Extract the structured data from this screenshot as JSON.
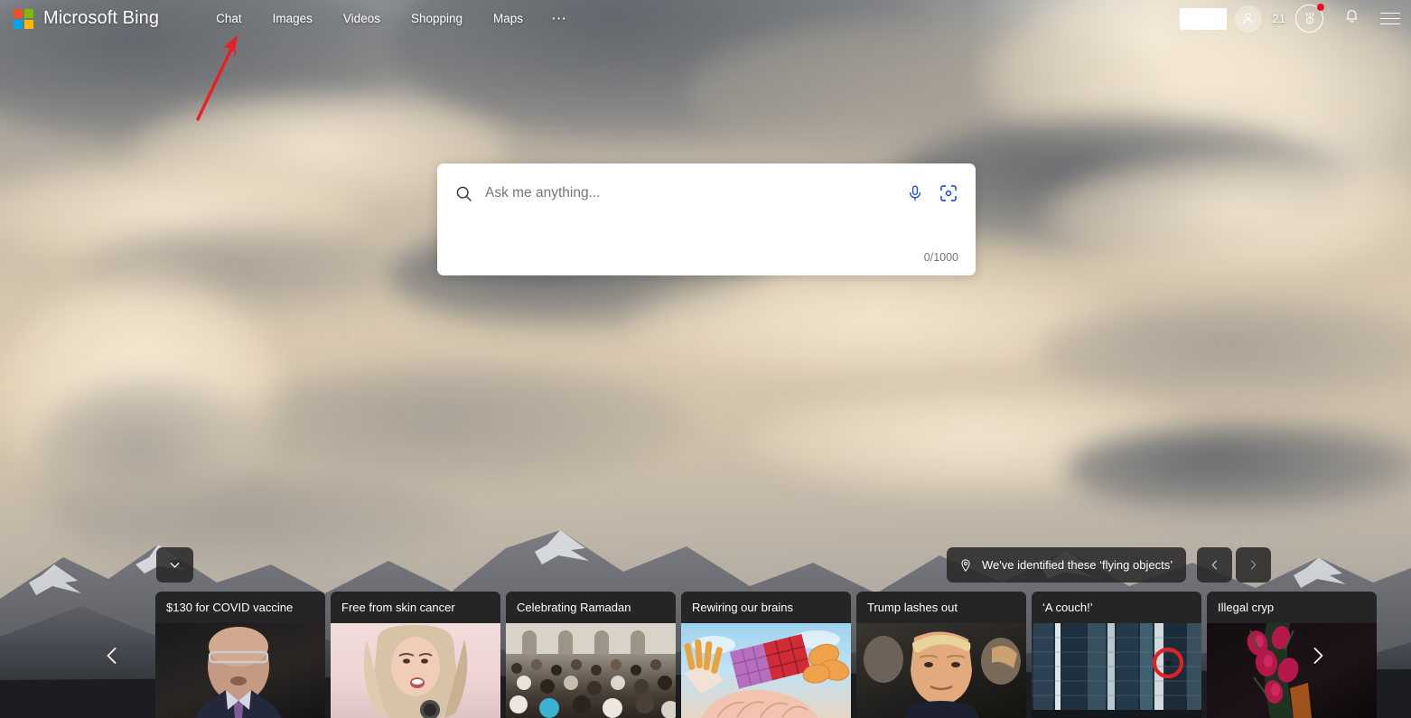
{
  "header": {
    "brand": "Microsoft Bing",
    "logo_colors": [
      "#f25022",
      "#7fba00",
      "#00a4ef",
      "#ffb900"
    ],
    "nav": [
      {
        "label": "Chat",
        "name": "nav-chat"
      },
      {
        "label": "Images",
        "name": "nav-images"
      },
      {
        "label": "Videos",
        "name": "nav-videos"
      },
      {
        "label": "Shopping",
        "name": "nav-shopping"
      },
      {
        "label": "Maps",
        "name": "nav-maps"
      }
    ],
    "more_label": "⋯",
    "rewards_points": "21",
    "icons": {
      "avatar": "person-icon",
      "rewards": "rewards-medal-icon",
      "notifications": "bell-icon",
      "menu": "hamburger-menu-icon"
    },
    "notification_dot_color": "#e81123"
  },
  "annotation": {
    "type": "arrow",
    "color": "#ee1c24",
    "points_to": "Chat"
  },
  "search": {
    "placeholder": "Ask me anything...",
    "value": "",
    "counter": "0/1000",
    "icons": {
      "search": "search-icon",
      "microphone": "microphone-icon",
      "visual_search": "visual-search-icon"
    },
    "icon_color": "#174ae4"
  },
  "bottom": {
    "collapse_icon": "chevron-down-icon",
    "location_badge": {
      "icon": "location-pin-icon",
      "text": "We've identified these ‘flying objects’"
    },
    "prev_icon": "chevron-left-icon",
    "next_icon": "chevron-right-icon",
    "scroll_left_icon": "chevron-left-icon",
    "scroll_right_icon": "chevron-right-icon",
    "cards": [
      {
        "title": "$130 for COVID vaccine",
        "art": "man-glasses-suit"
      },
      {
        "title": "Free from skin cancer",
        "art": "blonde-woman-microphone"
      },
      {
        "title": "Celebrating Ramadan",
        "art": "mosque-crowd"
      },
      {
        "title": "Rewiring our brains",
        "art": "food-collage-brain"
      },
      {
        "title": "Trump lashes out",
        "art": "trump-portrait"
      },
      {
        "title": "‘A couch!’",
        "art": "glass-tower-red-circle"
      },
      {
        "title": "Illegal cryp",
        "art": "dark-flowers"
      }
    ]
  }
}
